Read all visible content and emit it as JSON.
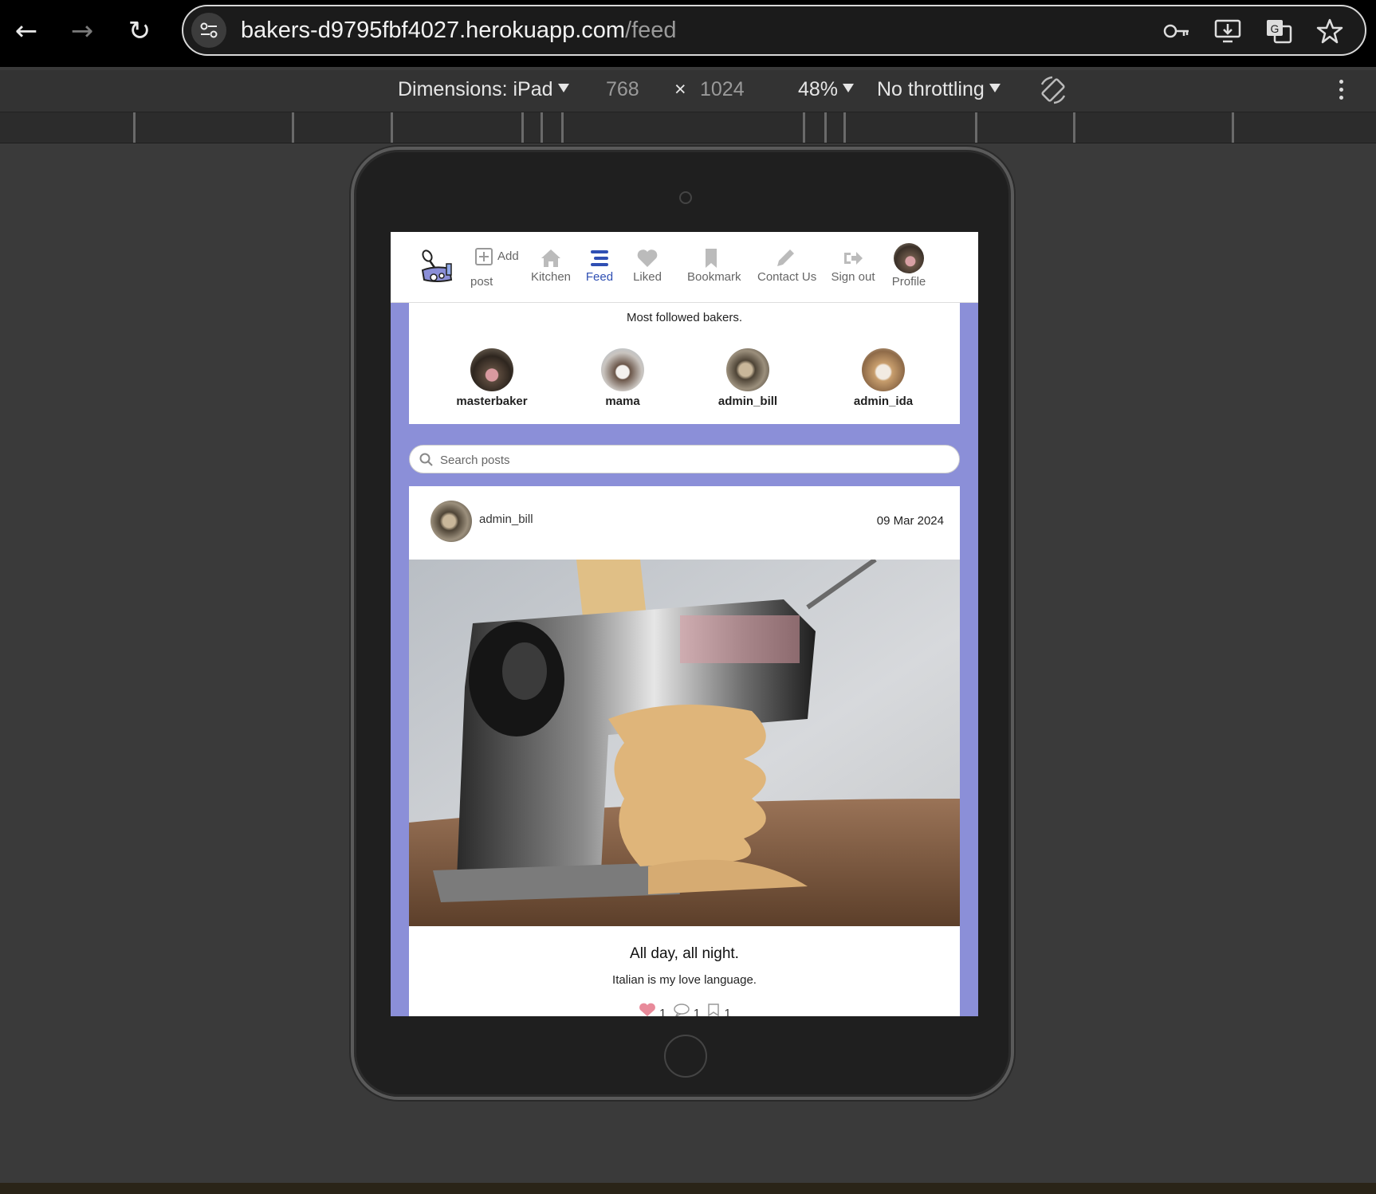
{
  "browser": {
    "url_host": "bakers-d9795fbf4027.herokuapp.com",
    "url_path": "/feed"
  },
  "devtools": {
    "dimensions_label": "Dimensions: iPad",
    "width": "768",
    "times": "×",
    "height": "1024",
    "zoom": "48%",
    "throttling": "No throttling"
  },
  "nav": {
    "add_label_top": "Add",
    "add_label_bottom": "post",
    "kitchen": "Kitchen",
    "feed": "Feed",
    "liked": "Liked",
    "bookmark": "Bookmark",
    "contact": "Contact Us",
    "signout": "Sign out",
    "profile": "Profile",
    "active_color": "#2f4fb3"
  },
  "followed": {
    "title": "Most followed bakers.",
    "bakers": [
      {
        "name": "masterbaker"
      },
      {
        "name": "mama"
      },
      {
        "name": "admin_bill"
      },
      {
        "name": "admin_ida"
      }
    ]
  },
  "search": {
    "placeholder": "Search posts"
  },
  "post": {
    "author": "admin_bill",
    "date": "09 Mar 2024",
    "title": "All day, all night.",
    "content": "Italian is my love language.",
    "likes": "1",
    "comments": "1",
    "bookmarks": "1"
  },
  "colors": {
    "page_bg": "#8b8fd8",
    "accent": "#2f4fb3"
  }
}
